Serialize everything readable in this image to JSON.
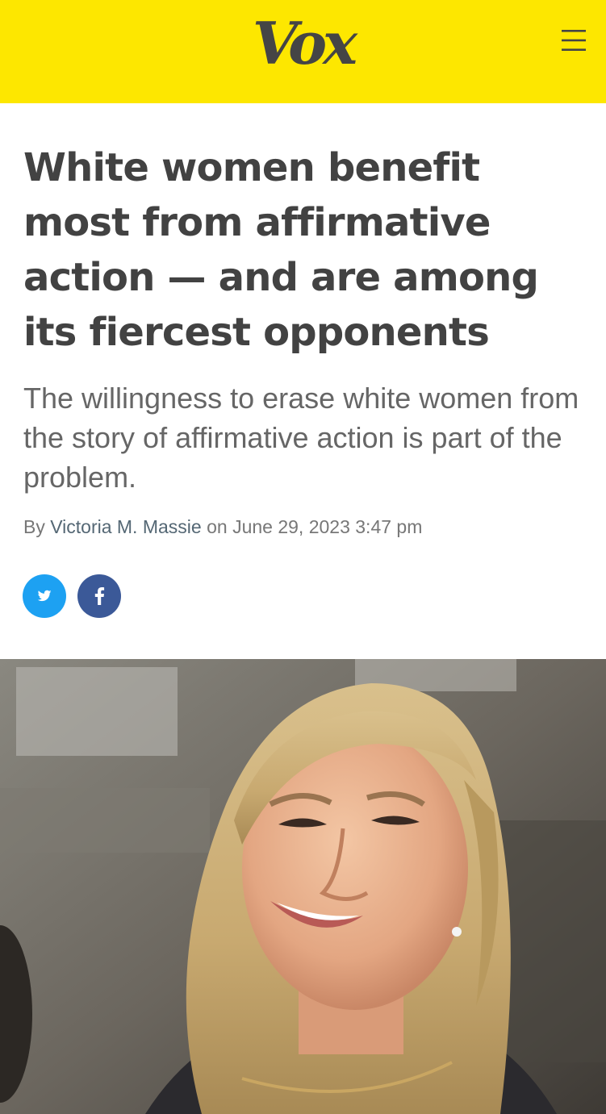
{
  "header": {
    "logo_text": "Vox",
    "background_color": "#fde700",
    "menu_icon": "hamburger-menu-icon"
  },
  "article": {
    "headline": "White women benefit most from affirmative action — and are among its fiercest opponents",
    "dek": "The willingness to erase white women from the story of affirmative action is part of the problem.",
    "byline": {
      "prefix": "By",
      "author": "Victoria M. Massie",
      "date_prefix": "on",
      "date": "June 29, 2023 3:47 pm"
    }
  },
  "share": {
    "twitter": {
      "icon": "twitter-icon",
      "color": "#1da1f2"
    },
    "facebook": {
      "icon": "facebook-icon",
      "color": "#3b5998"
    }
  },
  "hero_image": {
    "subject": "photo-of-smiling-blonde-woman"
  }
}
